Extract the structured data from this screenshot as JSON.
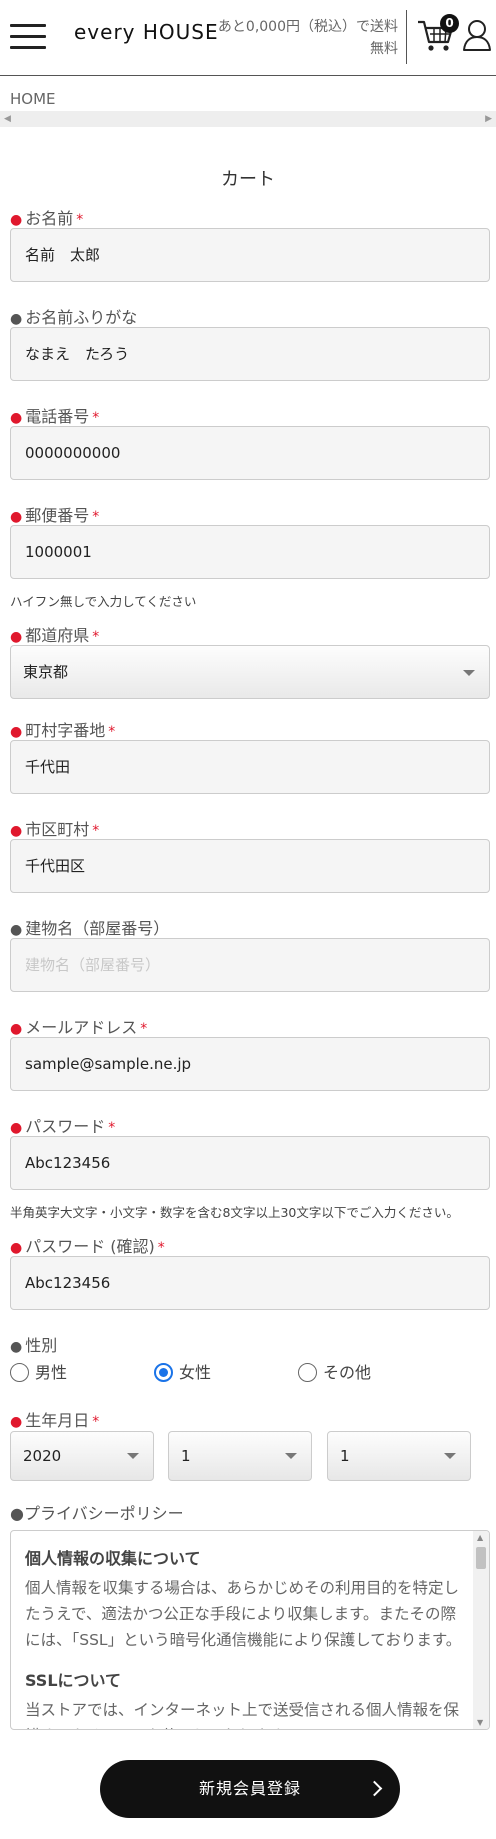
{
  "header": {
    "logo": "every HOUSE",
    "shipping_line1": "あと0,000円（税込）で送料",
    "shipping_line2": "無料",
    "cart_count": "0"
  },
  "breadcrumb": {
    "home": "HOME"
  },
  "page_title": "カート",
  "required_mark": "*",
  "fields": {
    "name": {
      "label": "お名前",
      "value": "名前　太郎"
    },
    "furigana": {
      "label": "お名前ふりがな",
      "value": "なまえ　たろう"
    },
    "phone": {
      "label": "電話番号",
      "value": "0000000000"
    },
    "postal": {
      "label": "郵便番号",
      "value": "1000001",
      "hint": "ハイフン無しで入力してください"
    },
    "prefecture": {
      "label": "都道府県",
      "value": "東京都"
    },
    "street": {
      "label": "町村字番地",
      "value": "千代田"
    },
    "city": {
      "label": "市区町村",
      "value": "千代田区"
    },
    "building": {
      "label": "建物名（部屋番号）",
      "placeholder": "建物名（部屋番号）"
    },
    "email": {
      "label": "メールアドレス",
      "value": "sample@sample.ne.jp"
    },
    "password": {
      "label": "パスワード",
      "value": "Abc123456",
      "hint": "半角英字大文字・小文字・数字を含む8文字以上30文字以下でご入力ください。"
    },
    "password_confirm": {
      "label": "パスワード (確認)",
      "value": "Abc123456"
    },
    "gender": {
      "label": "性別",
      "options": [
        "男性",
        "女性",
        "その他"
      ],
      "selected": "女性"
    },
    "birthday": {
      "label": "生年月日",
      "year": "2020",
      "month": "1",
      "day": "1"
    }
  },
  "privacy": {
    "label": "●プライバシーポリシー",
    "section1_title": "個人情報の収集について",
    "section1_body": "個人情報を収集する場合は、あらかじめその利用目的を特定したうえで、適法かつ公正な手段により収集します。またその際には、「SSL」という暗号化通信機能により保護しております。",
    "section2_title": "SSLについて",
    "section2_body": "当ストアでは、インターネット上で送受信される個人情報を保護するため、SSLを使用しております。"
  },
  "submit_label": "新規会員登録",
  "colors": {
    "required_dot": "#e0182d",
    "radio_accent": "#1a73e8",
    "button_bg": "#111111"
  }
}
